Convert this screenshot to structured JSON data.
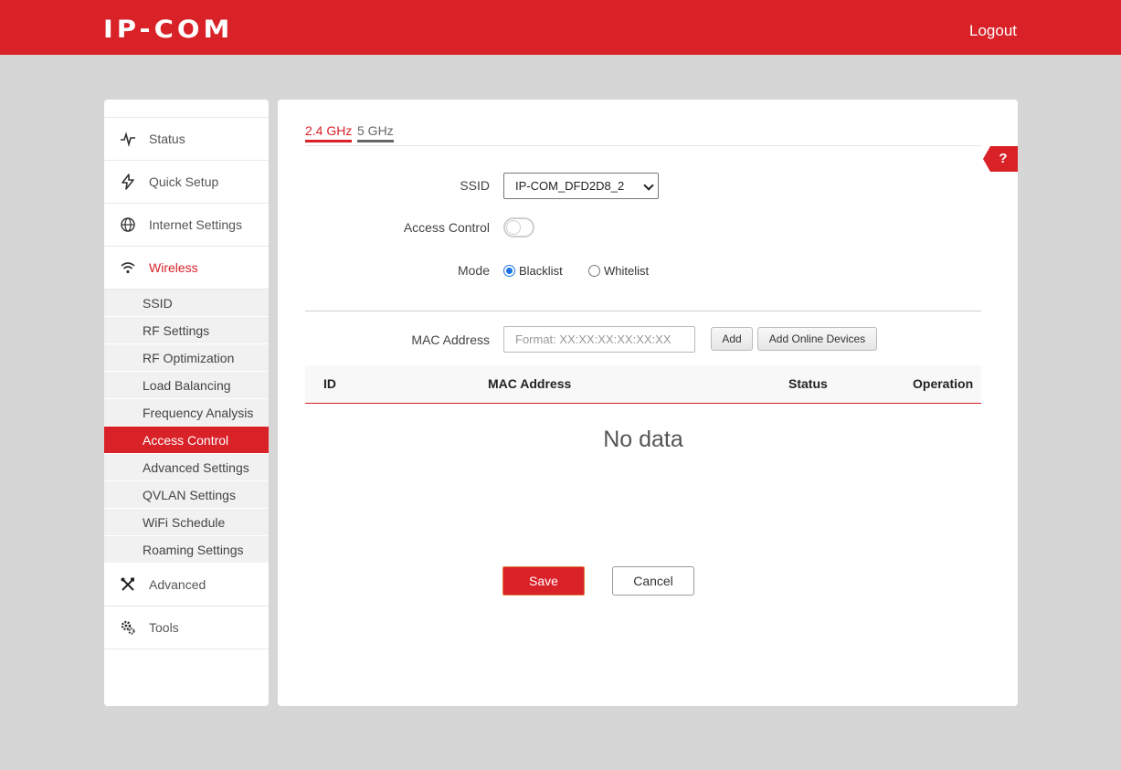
{
  "header": {
    "logo": "IP-COM",
    "logout": "Logout"
  },
  "sidebar": {
    "items": [
      {
        "label": "Status",
        "icon": "pulse-icon"
      },
      {
        "label": "Quick Setup",
        "icon": "lightning-icon"
      },
      {
        "label": "Internet Settings",
        "icon": "globe-icon"
      },
      {
        "label": "Wireless",
        "icon": "wifi-icon",
        "active": true
      },
      {
        "label": "Advanced",
        "icon": "tools-icon"
      },
      {
        "label": "Tools",
        "icon": "gears-icon"
      }
    ],
    "wireless_sub": [
      "SSID",
      "RF Settings",
      "RF Optimization",
      "Load Balancing",
      "Frequency Analysis",
      "Access Control",
      "Advanced Settings",
      "QVLAN Settings",
      "WiFi Schedule",
      "Roaming Settings"
    ],
    "active_sub": "Access Control"
  },
  "main": {
    "tabs": [
      "2.4 GHz",
      "5 GHz"
    ],
    "help": "?",
    "ssid_label": "SSID",
    "ssid_value": "IP-COM_DFD2D8_2",
    "access_control_label": "Access Control",
    "access_control_on": false,
    "mode_label": "Mode",
    "mode_options": [
      "Blacklist",
      "Whitelist"
    ],
    "mode_selected": "Blacklist",
    "mac_label": "MAC Address",
    "mac_placeholder": "Format: XX:XX:XX:XX:XX:XX",
    "add_button": "Add",
    "add_online_button": "Add Online Devices",
    "table_headers": [
      "ID",
      "MAC Address",
      "Status",
      "Operation"
    ],
    "no_data": "No data",
    "save": "Save",
    "cancel": "Cancel"
  },
  "colors": {
    "brand": "#d92128",
    "radio": "#1a73e8"
  }
}
